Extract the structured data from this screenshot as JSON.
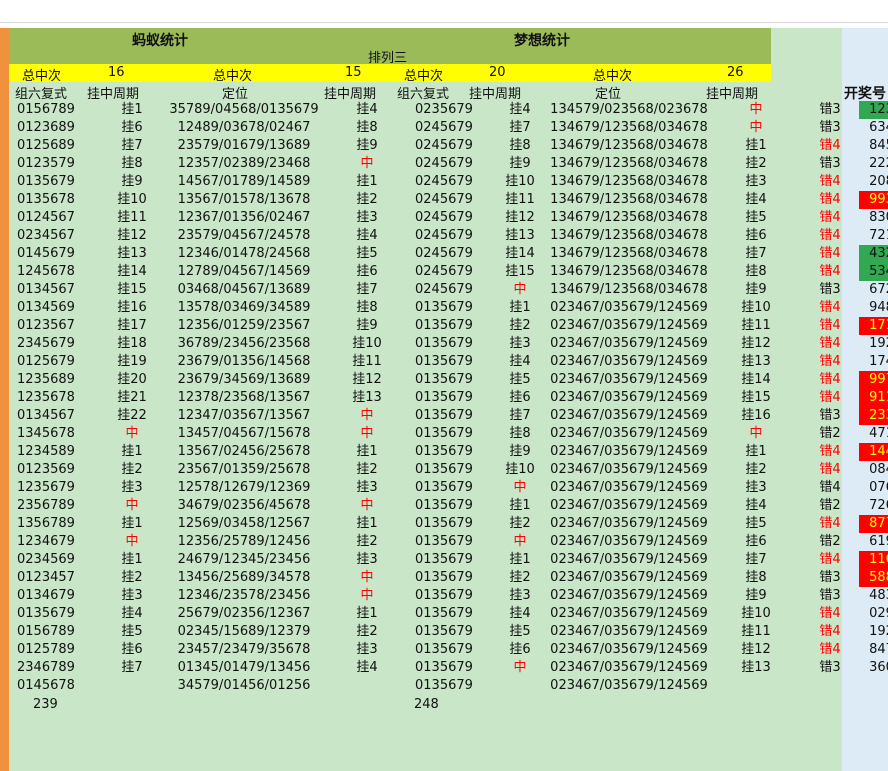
{
  "header": {
    "title_left": "蚂蚁统计",
    "title_right": "梦想统计",
    "subtitle": "排列三",
    "summary_labels": [
      "总中次",
      "16",
      "总中次",
      "15",
      "总中次",
      "20",
      "总中次",
      "26"
    ],
    "column_headers": [
      "组六复式",
      "挂中周期",
      "定位",
      "挂中周期",
      "组六复式",
      "挂中周期",
      "定位",
      "挂中周期",
      "",
      "开奖号"
    ]
  },
  "rows": [
    {
      "c": [
        "0156789",
        "挂1",
        "35789/04568/0135679",
        "挂4",
        "0235679",
        "挂4",
        "134579/023568/023678",
        "中",
        "错3",
        "123"
      ],
      "red": [
        7
      ],
      "k": "green"
    },
    {
      "c": [
        "0123689",
        "挂6",
        "12489/03678/02467",
        "挂8",
        "0245679",
        "挂7",
        "134679/123568/034678",
        "中",
        "错3",
        "634"
      ],
      "red": [
        7
      ],
      "k": ""
    },
    {
      "c": [
        "0125689",
        "挂7",
        "23579/01679/13689",
        "挂9",
        "0245679",
        "挂8",
        "134679/123568/034678",
        "挂1",
        "错4",
        "845"
      ],
      "red": [
        8
      ],
      "k": ""
    },
    {
      "c": [
        "0123579",
        "挂8",
        "12357/02389/23468",
        "中",
        "0245679",
        "挂9",
        "134679/123568/034678",
        "挂2",
        "错3",
        "222"
      ],
      "red": [
        3
      ],
      "k": ""
    },
    {
      "c": [
        "0135679",
        "挂9",
        "14567/01789/14589",
        "挂1",
        "0245679",
        "挂10",
        "134679/123568/034678",
        "挂3",
        "错4",
        "208"
      ],
      "red": [
        8
      ],
      "k": ""
    },
    {
      "c": [
        "0135678",
        "挂10",
        "13567/01578/13678",
        "挂2",
        "0245679",
        "挂11",
        "134679/123568/034678",
        "挂4",
        "错4",
        "993"
      ],
      "red": [
        8
      ],
      "k": "red"
    },
    {
      "c": [
        "0124567",
        "挂11",
        "12367/01356/02467",
        "挂3",
        "0245679",
        "挂12",
        "134679/123568/034678",
        "挂5",
        "错4",
        "830"
      ],
      "red": [
        8
      ],
      "k": ""
    },
    {
      "c": [
        "0234567",
        "挂12",
        "23579/04567/24578",
        "挂4",
        "0245679",
        "挂13",
        "134679/123568/034678",
        "挂6",
        "错4",
        "721"
      ],
      "red": [
        8
      ],
      "k": ""
    },
    {
      "c": [
        "0145679",
        "挂13",
        "12346/01478/24568",
        "挂5",
        "0245679",
        "挂14",
        "134679/123568/034678",
        "挂7",
        "错4",
        "432"
      ],
      "red": [
        8
      ],
      "k": "green"
    },
    {
      "c": [
        "1245678",
        "挂14",
        "12789/04567/14569",
        "挂6",
        "0245679",
        "挂15",
        "134679/123568/034678",
        "挂8",
        "错4",
        "534"
      ],
      "red": [
        8
      ],
      "k": "green"
    },
    {
      "c": [
        "0134567",
        "挂15",
        "03468/04567/13689",
        "挂7",
        "0245679",
        "中",
        "134679/123568/034678",
        "挂9",
        "错3",
        "672"
      ],
      "red": [
        5
      ],
      "k": ""
    },
    {
      "c": [
        "0134569",
        "挂16",
        "13578/03469/34589",
        "挂8",
        "0135679",
        "挂1",
        "023467/035679/124569",
        "挂10",
        "错4",
        "948"
      ],
      "red": [
        8
      ],
      "k": ""
    },
    {
      "c": [
        "0123567",
        "挂17",
        "12356/01259/23567",
        "挂9",
        "0135679",
        "挂2",
        "023467/035679/124569",
        "挂11",
        "错4",
        "171"
      ],
      "red": [
        8
      ],
      "k": "red"
    },
    {
      "c": [
        "2345679",
        "挂18",
        "36789/23456/23568",
        "挂10",
        "0135679",
        "挂3",
        "023467/035679/124569",
        "挂12",
        "错4",
        "192"
      ],
      "red": [
        8
      ],
      "k": ""
    },
    {
      "c": [
        "0125679",
        "挂19",
        "23679/01356/14568",
        "挂11",
        "0135679",
        "挂4",
        "023467/035679/124569",
        "挂13",
        "错4",
        "174"
      ],
      "red": [
        8
      ],
      "k": ""
    },
    {
      "c": [
        "1235689",
        "挂20",
        "23679/34569/13689",
        "挂12",
        "0135679",
        "挂5",
        "023467/035679/124569",
        "挂14",
        "错4",
        "997"
      ],
      "red": [
        8
      ],
      "k": "red"
    },
    {
      "c": [
        "1235678",
        "挂21",
        "12378/23568/13567",
        "挂13",
        "0135679",
        "挂6",
        "023467/035679/124569",
        "挂15",
        "错4",
        "911"
      ],
      "red": [
        8
      ],
      "k": "red"
    },
    {
      "c": [
        "0134567",
        "挂22",
        "12347/03567/13567",
        "中",
        "0135679",
        "挂7",
        "023467/035679/124569",
        "挂16",
        "错3",
        "233"
      ],
      "red": [
        3
      ],
      "k": "red"
    },
    {
      "c": [
        "1345678",
        "中",
        "13457/04567/15678",
        "中",
        "0135679",
        "挂8",
        "023467/035679/124569",
        "中",
        "错2",
        "471"
      ],
      "red": [
        1,
        3,
        7
      ],
      "k": ""
    },
    {
      "c": [
        "1234589",
        "挂1",
        "13567/02456/25678",
        "挂1",
        "0135679",
        "挂9",
        "023467/035679/124569",
        "挂1",
        "错4",
        "144"
      ],
      "red": [
        8
      ],
      "k": "red"
    },
    {
      "c": [
        "0123569",
        "挂2",
        "23567/01359/25678",
        "挂2",
        "0135679",
        "挂10",
        "023467/035679/124569",
        "挂2",
        "错4",
        "084"
      ],
      "red": [
        8
      ],
      "k": ""
    },
    {
      "c": [
        "1235679",
        "挂3",
        "12578/12679/12369",
        "挂3",
        "0135679",
        "中",
        "023467/035679/124569",
        "挂3",
        "错4",
        "076"
      ],
      "red": [
        5
      ],
      "k": ""
    },
    {
      "c": [
        "2356789",
        "中",
        "34679/02356/45678",
        "中",
        "0135679",
        "挂1",
        "023467/035679/124569",
        "挂4",
        "错2",
        "726"
      ],
      "red": [
        1,
        3
      ],
      "k": ""
    },
    {
      "c": [
        "1356789",
        "挂1",
        "12569/03458/12567",
        "挂1",
        "0135679",
        "挂2",
        "023467/035679/124569",
        "挂5",
        "错4",
        "877"
      ],
      "red": [
        8
      ],
      "k": "red"
    },
    {
      "c": [
        "1234679",
        "中",
        "12356/25789/12456",
        "挂2",
        "0135679",
        "中",
        "023467/035679/124569",
        "挂6",
        "错2",
        "619"
      ],
      "red": [
        1,
        5
      ],
      "k": ""
    },
    {
      "c": [
        "0234569",
        "挂1",
        "24679/12345/23456",
        "挂3",
        "0135679",
        "挂1",
        "023467/035679/124569",
        "挂7",
        "错4",
        "116"
      ],
      "red": [
        8
      ],
      "k": "red"
    },
    {
      "c": [
        "0123457",
        "挂2",
        "13456/25689/34578",
        "中",
        "0135679",
        "挂2",
        "023467/035679/124569",
        "挂8",
        "错3",
        "588"
      ],
      "red": [
        3
      ],
      "k": "red"
    },
    {
      "c": [
        "0134679",
        "挂3",
        "12346/23578/23456",
        "中",
        "0135679",
        "挂3",
        "023467/035679/124569",
        "挂9",
        "错3",
        "483"
      ],
      "red": [
        3
      ],
      "k": ""
    },
    {
      "c": [
        "0135679",
        "挂4",
        "25679/02356/12367",
        "挂1",
        "0135679",
        "挂4",
        "023467/035679/124569",
        "挂10",
        "错4",
        "029"
      ],
      "red": [
        8
      ],
      "k": ""
    },
    {
      "c": [
        "0156789",
        "挂5",
        "02345/15689/12379",
        "挂2",
        "0135679",
        "挂5",
        "023467/035679/124569",
        "挂11",
        "错4",
        "192"
      ],
      "red": [
        8
      ],
      "k": ""
    },
    {
      "c": [
        "0125789",
        "挂6",
        "23457/23479/35678",
        "挂3",
        "0135679",
        "挂6",
        "023467/035679/124569",
        "挂12",
        "错4",
        "847"
      ],
      "red": [
        8
      ],
      "k": ""
    },
    {
      "c": [
        "2346789",
        "挂7",
        "01345/01479/13456",
        "挂4",
        "0135679",
        "中",
        "023467/035679/124569",
        "挂13",
        "错3",
        "360"
      ],
      "red": [
        5
      ],
      "k": ""
    },
    {
      "c": [
        "0145678",
        "",
        "34579/01456/01256",
        "",
        "0135679",
        "",
        "023467/035679/124569",
        "",
        "",
        ""
      ],
      "red": [],
      "k": ""
    }
  ],
  "totals": {
    "left": "239",
    "right": "248"
  }
}
